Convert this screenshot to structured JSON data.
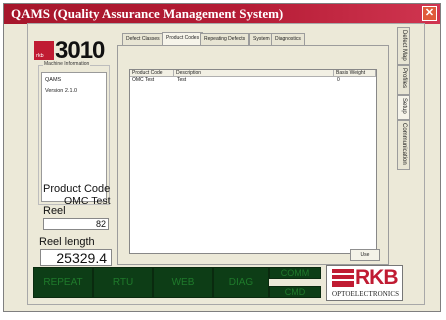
{
  "window": {
    "title": "QAMS (Quality Assurance Management System)",
    "close_glyph": "✕"
  },
  "logo": {
    "number": "3010",
    "mark_text": "rkb"
  },
  "machine_info": {
    "legend": "Machine Information",
    "lines": [
      "QAMS",
      "Version 2.1.0"
    ]
  },
  "product_code": {
    "label": "Product Code",
    "value": "OMC Test"
  },
  "reel": {
    "label": "Reel",
    "value": "82"
  },
  "reel_length": {
    "label": "Reel length",
    "value": "25329.4"
  },
  "tabs": [
    "Defect Classes",
    "Product Codes",
    "Repeating Defects",
    "System",
    "Diagnostics"
  ],
  "active_tab": "Product Codes",
  "table": {
    "columns": [
      "Product Code",
      "Description",
      "Basis Weight"
    ],
    "rows": [
      {
        "product_code": "OMC Test",
        "description": "Test",
        "basis_weight": "0"
      }
    ]
  },
  "use_button": "Use",
  "side_tabs": [
    "Defect Map",
    "Profiles",
    "Setup",
    "Communication"
  ],
  "bottom_buttons": [
    "REPEAT",
    "RTU",
    "WEB",
    "DIAG"
  ],
  "status_buttons": [
    "COMM",
    "CMD"
  ],
  "brand": {
    "name": "RKB",
    "subtitle": "OPTOELECTRONICS"
  },
  "colors": {
    "title_red": "#b51c35",
    "panel_green": "#0d3d16",
    "brand_red": "#c01b32"
  }
}
